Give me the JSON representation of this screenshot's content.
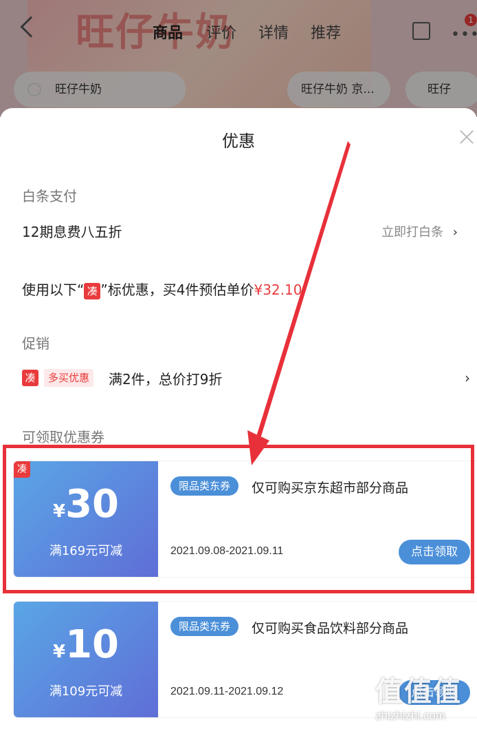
{
  "background": {
    "banner_text": "旺仔牛奶",
    "tabs": [
      "商品",
      "评价",
      "详情",
      "推荐"
    ],
    "badge": "1",
    "search_items": [
      "旺仔牛奶",
      "旺仔牛奶 京...",
      "旺仔"
    ]
  },
  "sheet": {
    "title": "优惠",
    "baitiao": {
      "label": "白条支付",
      "offer": "12期息费八五折",
      "action": "立即打白条",
      "chevron": "›"
    },
    "estimate": {
      "prefix": "使用以下“",
      "tag": "凑",
      "middle": "”标优惠，买4件预估单价",
      "price": "¥32.10"
    },
    "promotion": {
      "label": "促销",
      "tag": "凑",
      "badge": "多买优惠",
      "text": "满2件，总价打9折",
      "chevron": "›"
    },
    "coupons_label": "可领取优惠券",
    "coupons": [
      {
        "corner": "凑",
        "yen": "¥",
        "amount": "30",
        "condition": "满169元可减",
        "type": "限品类东券",
        "desc": "仅可购买京东超市部分商品",
        "date": "2021.09.08-2021.09.11",
        "button": "点击领取"
      },
      {
        "yen": "¥",
        "amount": "10",
        "condition": "满109元可减",
        "type": "限品类东券",
        "desc": "仅可购买食品饮料部分商品",
        "date": "2021.09.11-2021.09.12",
        "button": "点击领取"
      }
    ]
  },
  "watermark": {
    "logo": "值值值",
    "url": "zhizhizhi.com"
  },
  "colors": {
    "accent_red": "#e93b3d",
    "coupon_blue": "#4b8fd8",
    "highlight_red": "#e8303a"
  }
}
